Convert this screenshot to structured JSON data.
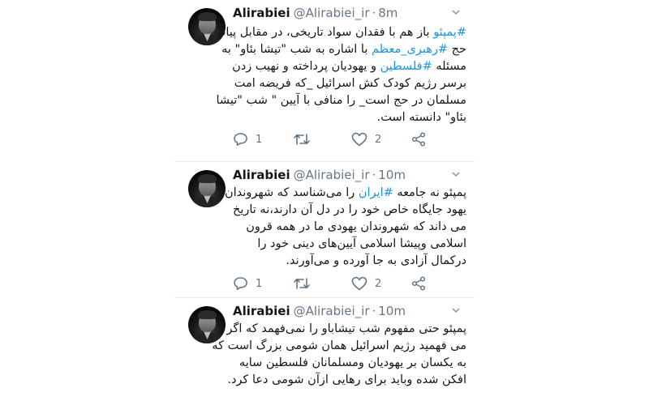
{
  "colors": {
    "name": "#14171a",
    "meta": "#657786",
    "hashtag": "#1b95e0",
    "divider": "#e6ecf0"
  },
  "icons": {
    "reply": "reply-icon",
    "retweet": "retweet-icon",
    "like": "heart-icon",
    "share": "share-icon",
    "caret": "chevron-down-icon"
  },
  "tweets": [
    {
      "name": "Alirabiei",
      "handle": "@Alirabiei_ir",
      "dot": "·",
      "time": "8m",
      "lines": [
        [
          {
            "t": "#پمپئو",
            "h": true
          },
          {
            "t": " باز هم با فقدان سواد تاریخی، در مقابل پیام",
            "h": false
          }
        ],
        [
          {
            "t": "حج ",
            "h": false
          },
          {
            "t": "#رهبری_معظم",
            "h": true
          },
          {
            "t": " با اشاره به شب \"تیشا بئاو\" به",
            "h": false
          }
        ],
        [
          {
            "t": "مسئله ",
            "h": false
          },
          {
            "t": "#فلسطین",
            "h": true
          },
          {
            "t": " و یهودیان پرداخته و نهیب زدن",
            "h": false
          }
        ],
        [
          {
            "t": "برسر رژیم کودک کش اسرائیل _که فریضه امت",
            "h": false
          }
        ],
        [
          {
            "t": "مسلمان در حج است_ را منافی با آیین \" شب \"تیشا",
            "h": false
          }
        ],
        [
          {
            "t": "بئاو\" دانسته است.",
            "h": false
          }
        ]
      ],
      "reply_count": "1",
      "retweet_count": "",
      "like_count": "2"
    },
    {
      "name": "Alirabiei",
      "handle": "@Alirabiei_ir",
      "dot": "·",
      "time": "10m",
      "lines": [
        [
          {
            "t": "پمپئو نه جامعه ",
            "h": false
          },
          {
            "t": "#ایران",
            "h": true
          },
          {
            "t": " را می‌شناسد که شهروندان",
            "h": false
          }
        ],
        [
          {
            "t": "یهود جایگاه خاص خود را در دل آن دارند،نه تاریخ",
            "h": false
          }
        ],
        [
          {
            "t": "می داند که شهروندان یهودی ما در همه قرون",
            "h": false
          }
        ],
        [
          {
            "t": "اسلامی وپیشا اسلامی آیین‌های دینی خود را",
            "h": false
          }
        ],
        [
          {
            "t": "درکمال آزادی به جا آورده و می‌آورند.",
            "h": false
          }
        ]
      ],
      "reply_count": "1",
      "retweet_count": "",
      "like_count": "2"
    },
    {
      "name": "Alirabiei",
      "handle": "@Alirabiei_ir",
      "dot": "·",
      "time": "10m",
      "lines": [
        [
          {
            "t": "پمپئو حتی مفهوم شب تیشاباو را نمی‌فهمد که اگر",
            "h": false
          }
        ],
        [
          {
            "t": "می فهمید رژیم اسرائیل همان شومی بزرگ است که",
            "h": false
          }
        ],
        [
          {
            "t": "به یکسان بر یهودیان ومسلمانان فلسطین سایه",
            "h": false
          }
        ],
        [
          {
            "t": "افکن شده وباید برای رهایی ازآن شومی دعا کرد.",
            "h": false
          }
        ]
      ]
    }
  ]
}
